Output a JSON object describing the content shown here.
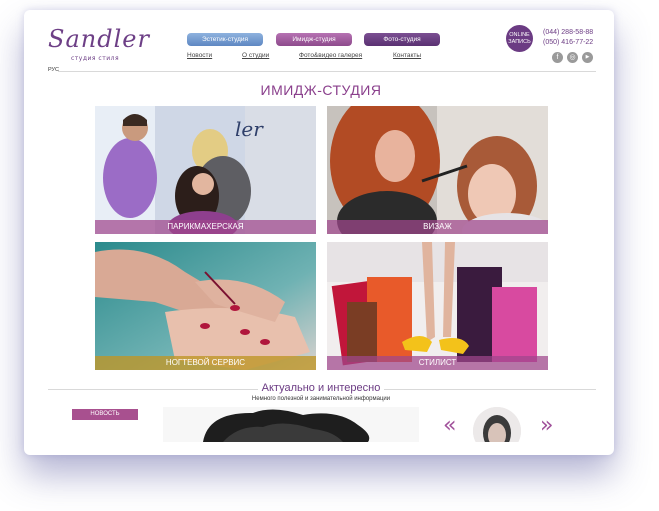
{
  "logo": {
    "name": "Sandler",
    "subtitle": "студия стиля"
  },
  "nav_buttons": {
    "estetic": "Эстетик-студия",
    "image": "Имидж-студия",
    "photo": "Фото-студия"
  },
  "nav_links": [
    "Новости",
    "О студии",
    "Фото&видео галерея",
    "Контакты"
  ],
  "online": {
    "line1": "ONLINE",
    "line2": "ЗАПИСЬ"
  },
  "phones": [
    "(044) 288-58-88",
    "(050) 416-77-22"
  ],
  "social": {
    "facebook": "f",
    "instagram": "◎",
    "youtube": "▶"
  },
  "language": "РУС",
  "main_title": "ИМИДЖ-СТУДИЯ",
  "tiles": [
    {
      "caption": "ПАРИКМАХЕРСКАЯ"
    },
    {
      "caption": "ВИЗАЖ"
    },
    {
      "caption": "НОГТЕВОЙ СЕРВИС"
    },
    {
      "caption": "СТИЛИСТ"
    }
  ],
  "news": {
    "title": "Актуально и интересно",
    "subtitle": "Немного полезной и занимательной информации",
    "badge": "НОВОСТЬ"
  },
  "carousel": {
    "prev": "«",
    "next": "»"
  },
  "colors": {
    "brand_purple": "#6b3b83",
    "accent_magenta": "#a8508f",
    "estetic_blue": "#7aa0d2"
  }
}
